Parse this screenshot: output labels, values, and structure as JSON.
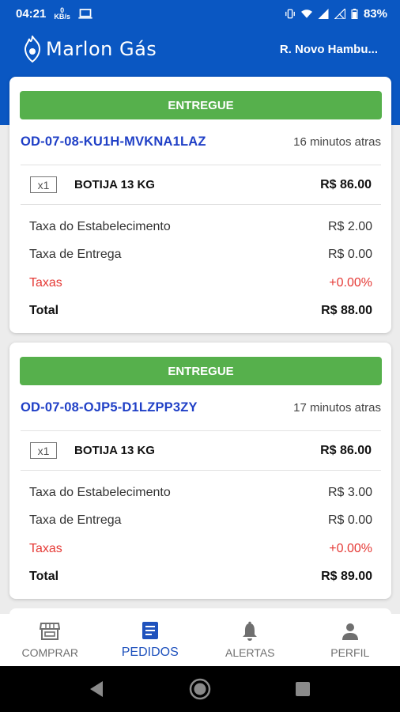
{
  "status_bar": {
    "time": "04:21",
    "battery_percent": "83%"
  },
  "app": {
    "brand_name": "Marlon Gás",
    "address": "R. Novo Hambu..."
  },
  "orders": [
    {
      "status": "ENTREGUE",
      "code": "OD-07-08-KU1H-MVKNA1LAZ",
      "time_ago": "16 minutos atras",
      "item": {
        "qty": "x1",
        "name": "BOTIJA 13 KG",
        "price": "R$ 86.00"
      },
      "fees": [
        {
          "label": "Taxa do Estabelecimento",
          "value": "R$ 2.00"
        },
        {
          "label": "Taxa de Entrega",
          "value": "R$ 0.00"
        },
        {
          "label": "Taxas",
          "value": "+0.00%"
        }
      ],
      "total": {
        "label": "Total",
        "value": "R$ 88.00"
      }
    },
    {
      "status": "ENTREGUE",
      "code": "OD-07-08-OJP5-D1LZPP3ZY",
      "time_ago": "17 minutos atras",
      "item": {
        "qty": "x1",
        "name": "BOTIJA 13 KG",
        "price": "R$ 86.00"
      },
      "fees": [
        {
          "label": "Taxa do Estabelecimento",
          "value": "R$ 3.00"
        },
        {
          "label": "Taxa de Entrega",
          "value": "R$ 0.00"
        },
        {
          "label": "Taxas",
          "value": "+0.00%"
        }
      ],
      "total": {
        "label": "Total",
        "value": "R$ 89.00"
      }
    }
  ],
  "bottom_nav": [
    {
      "label": "COMPRAR",
      "icon": "store-icon"
    },
    {
      "label": "PEDIDOS",
      "icon": "document-icon",
      "active": true
    },
    {
      "label": "ALERTAS",
      "icon": "bell-icon"
    },
    {
      "label": "PERFIL",
      "icon": "person-icon"
    }
  ],
  "colors": {
    "primary": "#0a57c2",
    "status_delivered": "#56b04c",
    "order_code": "#1f3fc6",
    "tax_red": "#e53935",
    "nav_active": "#1f52bd"
  }
}
